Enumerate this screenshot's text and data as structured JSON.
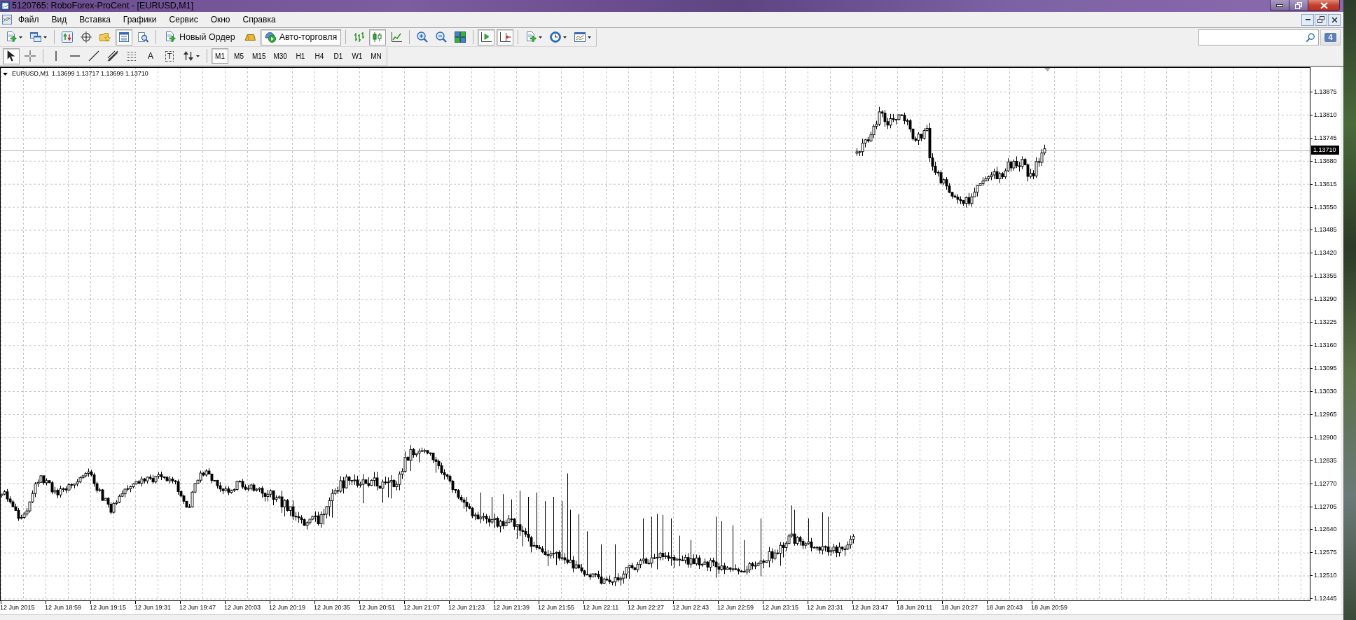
{
  "window": {
    "title": "5120765: RoboForex-ProCent - [EURUSD,M1]"
  },
  "menu": {
    "items": [
      "Файл",
      "Вид",
      "Вставка",
      "Графики",
      "Сервис",
      "Окно",
      "Справка"
    ]
  },
  "toolbar": {
    "groups": [
      [
        {
          "kind": "icon",
          "pressed": false
        },
        {
          "kind": "icon",
          "pressed": false
        }
      ],
      [
        {
          "kind": "icon",
          "pressed": false
        },
        {
          "kind": "icon",
          "pressed": false
        },
        {
          "kind": "icon",
          "pressed": false
        },
        {
          "kind": "icon",
          "pressed": true
        },
        {
          "kind": "icon",
          "pressed": false
        }
      ],
      [
        {
          "kind": "label",
          "label": "Новый Ордер",
          "pressed": false
        },
        {
          "kind": "icon",
          "pressed": false
        },
        {
          "kind": "label",
          "label": "Авто-торговля",
          "pressed": true
        }
      ],
      [
        {
          "kind": "icon",
          "pressed": false
        },
        {
          "kind": "icon",
          "pressed": true
        },
        {
          "kind": "icon",
          "pressed": false
        }
      ],
      [
        {
          "kind": "icon",
          "pressed": false
        },
        {
          "kind": "icon",
          "pressed": false
        },
        {
          "kind": "icon",
          "pressed": false
        }
      ],
      [
        {
          "kind": "icon",
          "pressed": true
        },
        {
          "kind": "icon",
          "pressed": true
        }
      ],
      [
        {
          "kind": "icon",
          "pressed": false
        },
        {
          "kind": "icon",
          "pressed": false
        },
        {
          "kind": "icon",
          "pressed": false
        }
      ]
    ]
  },
  "messages": {
    "count": "4"
  },
  "drawing_toolbar": {
    "groups": [
      [
        {
          "kind": "icon",
          "pressed": true
        },
        {
          "kind": "icon",
          "pressed": false
        }
      ],
      [
        {
          "kind": "icon",
          "pressed": false
        },
        {
          "kind": "icon",
          "pressed": false
        },
        {
          "kind": "icon",
          "pressed": false
        },
        {
          "kind": "icon",
          "pressed": false
        },
        {
          "kind": "icon",
          "pressed": false
        },
        {
          "kind": "glyph",
          "glyph": "A",
          "pressed": false
        },
        {
          "kind": "boxed-glyph",
          "glyph": "T",
          "pressed": false
        },
        {
          "kind": "icon",
          "pressed": false
        }
      ]
    ]
  },
  "timeframes": [
    {
      "label": "M1",
      "selected": true
    },
    {
      "label": "M5",
      "selected": false
    },
    {
      "label": "M15",
      "selected": false
    },
    {
      "label": "M30",
      "selected": false
    },
    {
      "label": "H1",
      "selected": false
    },
    {
      "label": "H4",
      "selected": false
    },
    {
      "label": "D1",
      "selected": false
    },
    {
      "label": "W1",
      "selected": false
    },
    {
      "label": "MN",
      "selected": false
    }
  ],
  "chart": {
    "symbol": "EURUSD,M1",
    "quote": "1.13699 1.13717 1.13699 1.13710",
    "price_labels": [
      "1.13875",
      "1.13810",
      "1.13745",
      "1.13680",
      "1.13615",
      "1.13550",
      "1.13485",
      "1.13420",
      "1.13355",
      "1.13290",
      "1.13225",
      "1.13160",
      "1.13095",
      "1.13030",
      "1.12965",
      "1.12900",
      "1.12835",
      "1.12770",
      "1.12705",
      "1.12640",
      "1.12575",
      "1.12510",
      "1.12445"
    ],
    "current_price": "1.13710",
    "time_labels": [
      "12 Jun 2015",
      "12 Jun 18:59",
      "12 Jun 19:15",
      "12 Jun 19:31",
      "12 Jun 19:47",
      "12 Jun 20:03",
      "12 Jun 20:19",
      "12 Jun 20:35",
      "12 Jun 20:51",
      "12 Jun 21:07",
      "12 Jun 21:23",
      "12 Jun 21:39",
      "12 Jun 21:55",
      "12 Jun 22:11",
      "12 Jun 22:27",
      "12 Jun 22:43",
      "12 Jun 22:59",
      "12 Jun 23:15",
      "12 Jun 23:31",
      "12 Jun 23:47",
      "18 Jun 20:11",
      "18 Jun 20:27",
      "18 Jun 20:43",
      "18 Jun 20:59"
    ]
  }
}
